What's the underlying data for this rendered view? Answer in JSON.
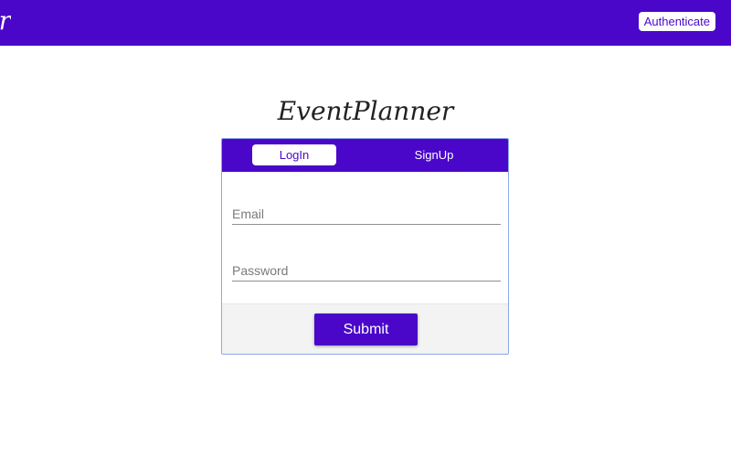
{
  "header": {
    "brand_fragment": "r",
    "authenticate_label": "Authenticate"
  },
  "main": {
    "app_title": "EventPlanner",
    "tabs": [
      {
        "label": "LogIn",
        "active": true
      },
      {
        "label": "SignUp",
        "active": false
      }
    ],
    "form": {
      "email_placeholder": "Email",
      "email_value": "",
      "password_placeholder": "Password",
      "password_value": "",
      "submit_label": "Submit"
    }
  },
  "colors": {
    "brand": "#4a07c9",
    "card_border": "#8aa8e8",
    "footer_background": "#f3f3f3"
  }
}
